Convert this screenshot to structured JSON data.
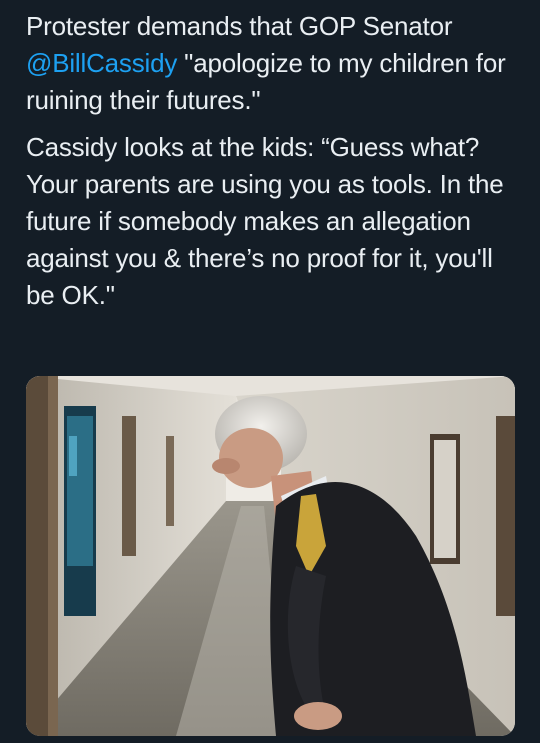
{
  "tweet": {
    "para1": {
      "lead": "Protester demands that GOP Senator",
      "mention": "@BillCassidy",
      "rest": " \"apologize to my children for ruining their futures.\""
    },
    "para2": "Cassidy looks at the kids: “Guess what? Your parents are using you as tools. In the future if somebody makes an allegation against you & there’s no proof for it, you'll be OK.\""
  },
  "media": {
    "type": "video-still",
    "icon": "video-frame"
  },
  "colors": {
    "background": "#141d26",
    "text": "#e9eef2",
    "mention": "#1da1f2"
  }
}
